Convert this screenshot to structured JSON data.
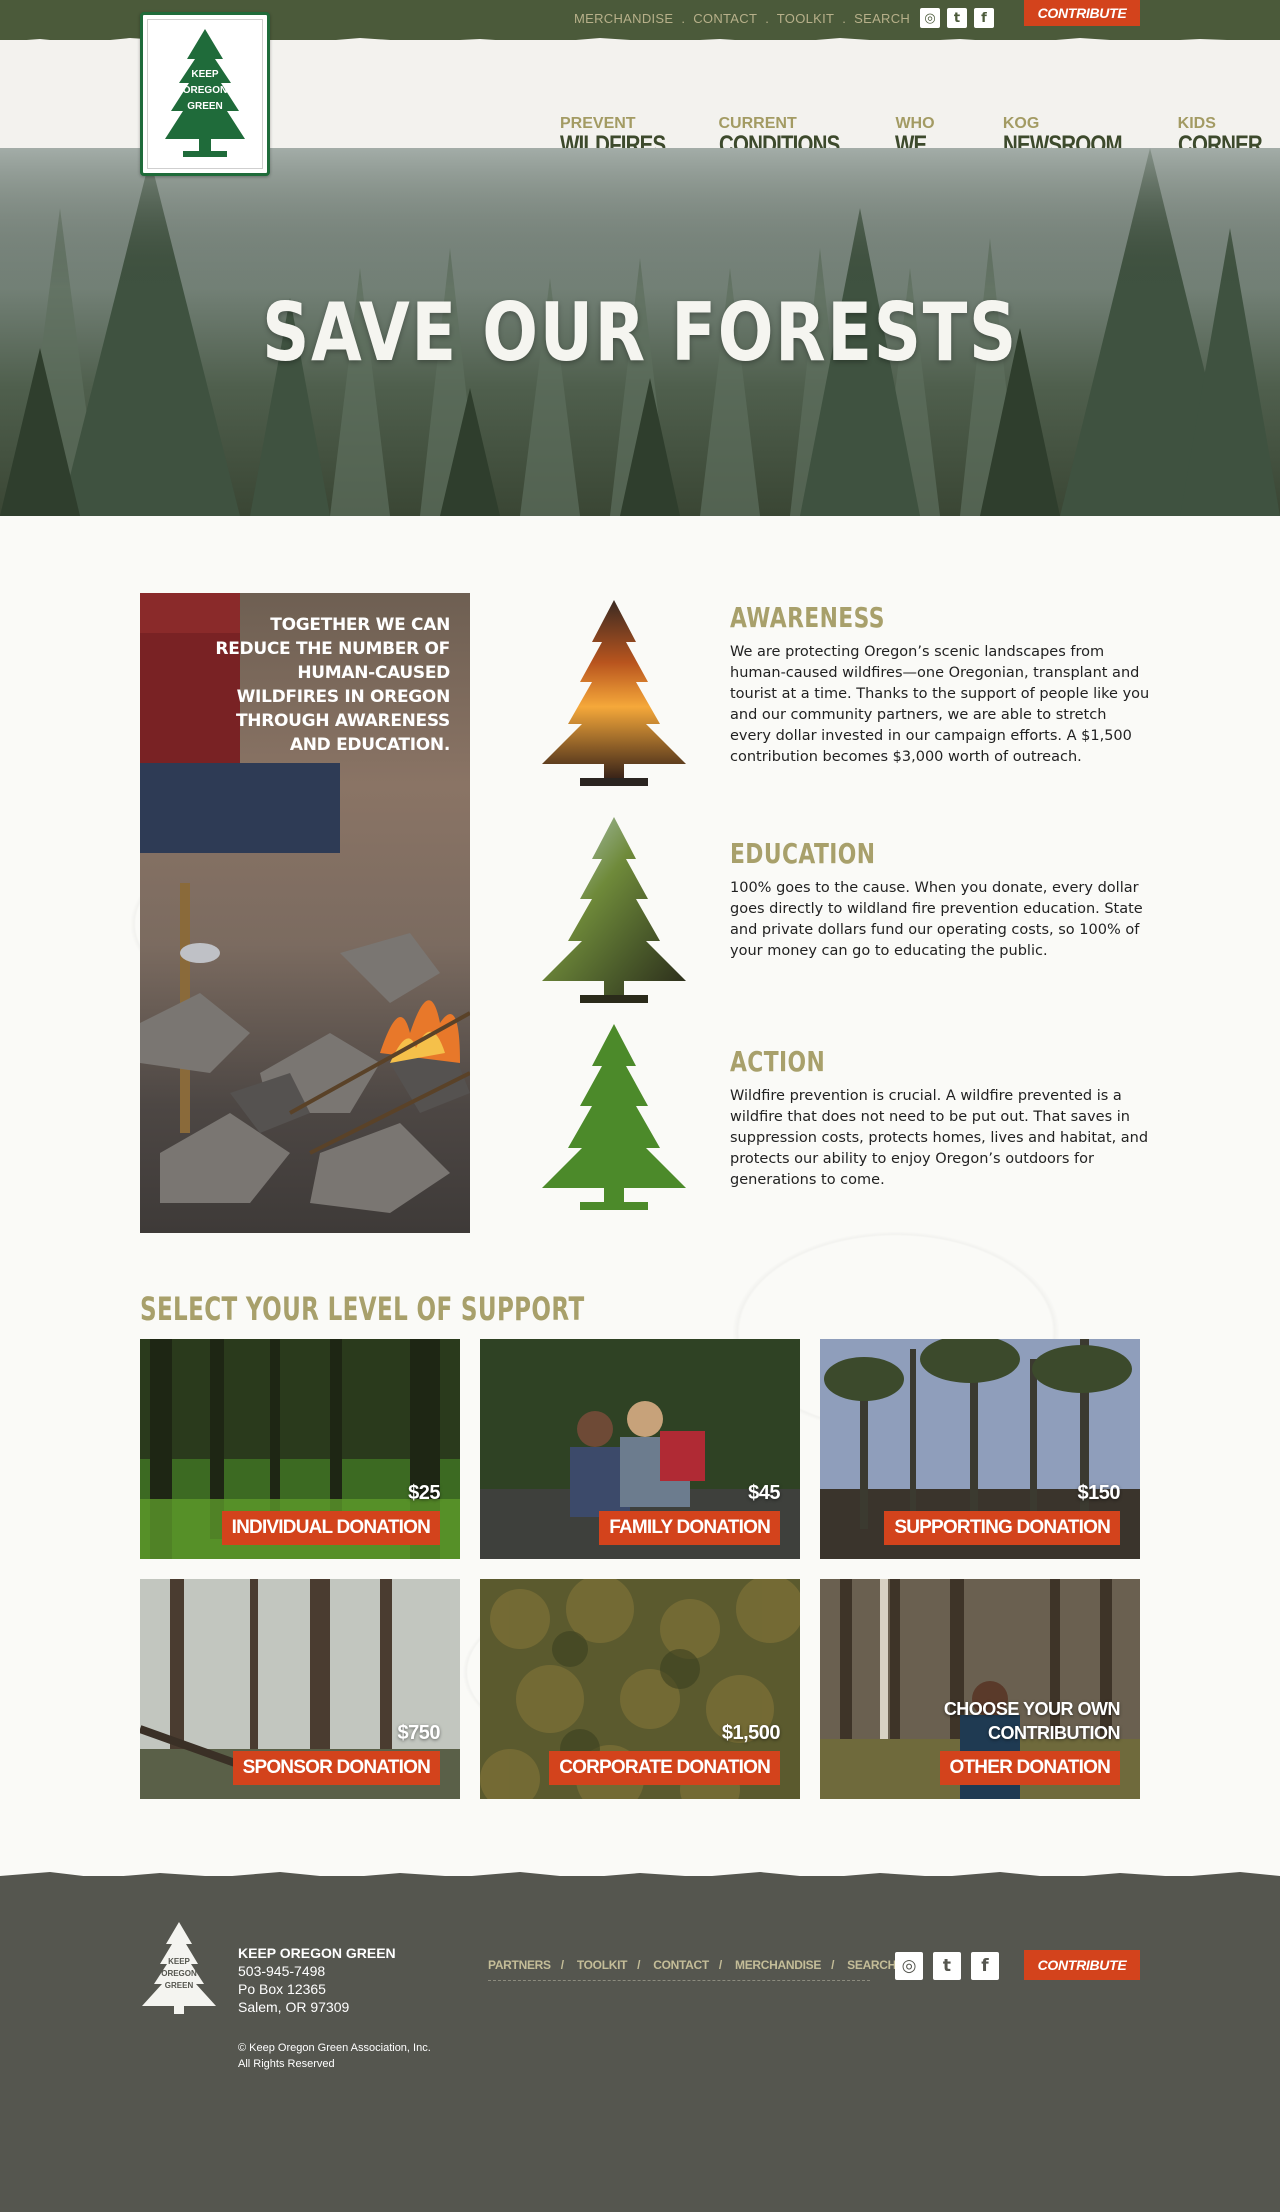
{
  "header": {
    "utility_links": [
      "MERCHANDISE",
      "CONTACT",
      "TOOLKIT",
      "SEARCH"
    ],
    "social_icons": [
      "instagram-icon",
      "twitter-icon",
      "facebook-icon"
    ],
    "contribute_label": "CONTRIBUTE",
    "logo_text": "KEEP OREGON GREEN",
    "nav": [
      {
        "small": "PREVENT",
        "big": "WILDFIRES"
      },
      {
        "small": "CURRENT",
        "big": "CONDITIONS"
      },
      {
        "small": "WHO",
        "big": "WE ARE"
      },
      {
        "small": "KOG",
        "big": "NEWSROOM"
      },
      {
        "small": "KIDS",
        "big": "CORNER"
      }
    ]
  },
  "hero": {
    "title": "SAVE OUR FORESTS"
  },
  "feature": {
    "quote": "TOGETHER WE CAN REDUCE THE NUMBER OF HUMAN-CAUSED WILDFIRES IN OREGON THROUGH AWARENESS AND EDUCATION."
  },
  "pillars": [
    {
      "title": "AWARENESS",
      "text": "We are protecting Oregon’s scenic landscapes from human-caused wildfires—one Oregonian, transplant and tourist at a time. Thanks to the support of people like you and our community partners, we are able to stretch every dollar invested in our campaign efforts. A $1,500 contribution becomes $3,000 worth of outreach."
    },
    {
      "title": "EDUCATION",
      "text": "100% goes to the cause. When you donate, every dollar goes directly to wildland fire prevention education. State and private dollars fund our operating costs, so 100% of your money can go to educating the public."
    },
    {
      "title": "ACTION",
      "text": "Wildfire prevention is crucial. A wildfire prevented is a wildfire that does not need to be put out. That saves in suppression costs, protects homes, lives and habitat, and protects our ability to enjoy Oregon’s outdoors for generations to come."
    }
  ],
  "support": {
    "title": "SELECT YOUR LEVEL OF SUPPORT",
    "tiles": [
      {
        "amount": "$25",
        "label": "INDIVIDUAL DONATION",
        "colors": [
          "#2f4a1c",
          "#4f7a22",
          "#6a9a2e"
        ]
      },
      {
        "amount": "$45",
        "label": "FAMILY DONATION",
        "colors": [
          "#2b3a26",
          "#4c5c44",
          "#3a3c38"
        ]
      },
      {
        "amount": "$150",
        "label": "SUPPORTING DONATION",
        "colors": [
          "#9aa7bd",
          "#5a5e58",
          "#3b3630"
        ]
      },
      {
        "amount": "$750",
        "label": "SPONSOR DONATION",
        "colors": [
          "#c9ccc6",
          "#7a8070",
          "#4a4e40"
        ]
      },
      {
        "amount": "$1,500",
        "label": "CORPORATE DONATION",
        "colors": [
          "#5a5a2e",
          "#6b6a36",
          "#3f4422"
        ]
      },
      {
        "extra": "CHOOSE YOUR OWN CONTRIBUTION",
        "label": "OTHER DONATION",
        "colors": [
          "#6b6255",
          "#8b8068",
          "#5a5a3a"
        ]
      }
    ]
  },
  "footer": {
    "org": "KEEP OREGON GREEN",
    "phone": "503-945-7498",
    "po_box": "Po Box 12365",
    "city": "Salem, OR 97309",
    "copyright": "© Keep Oregon Green Association, Inc.",
    "rights": "All Rights Reserved",
    "links": [
      "PARTNERS",
      "TOOLKIT",
      "CONTACT",
      "MERCHANDISE",
      "SEARCH"
    ],
    "contribute_label": "CONTRIBUTE"
  }
}
